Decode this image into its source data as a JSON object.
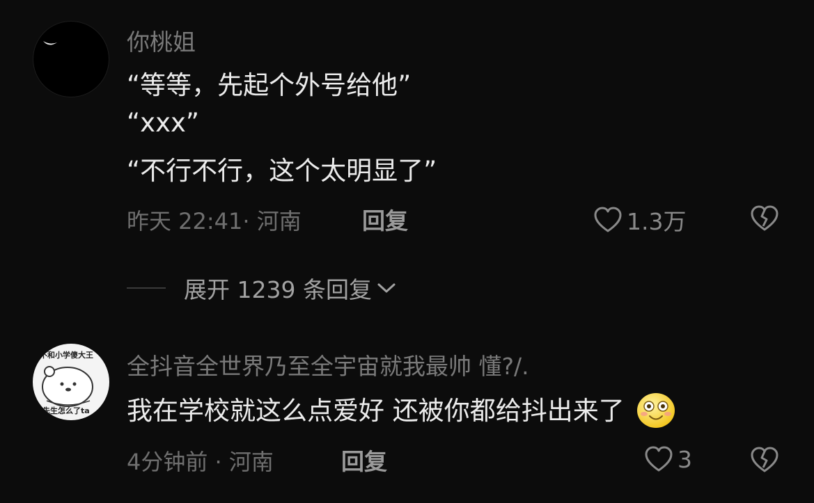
{
  "comments": [
    {
      "username": "你桃姐",
      "lines": [
        "“等等，先起个外号给他”",
        "“xxx”",
        "“不行不行，这个太明显了”"
      ],
      "time_location": "昨天 22:41· 河南",
      "reply_label": "回复",
      "likes": "1.3万",
      "avatar_icon": "crescent-moon-icon"
    },
    {
      "username": "全抖音全世界乃至全宇宙就我最帅 懂?/.",
      "text": "我在学校就这么点爱好 还被你都给抖出来了",
      "emoji": "smiling-face-icon",
      "time_location": "4分钟前 · 河南",
      "reply_label": "回复",
      "likes": "3",
      "avatar_text_top": "不和小学傻大王",
      "avatar_text_bottom": "先生怎么了ta"
    }
  ],
  "expand_replies": {
    "label": "展开 1239 条回复"
  },
  "icons": {
    "like": "heart-outline-icon",
    "dislike": "broken-heart-icon",
    "expand": "chevron-down-icon"
  }
}
